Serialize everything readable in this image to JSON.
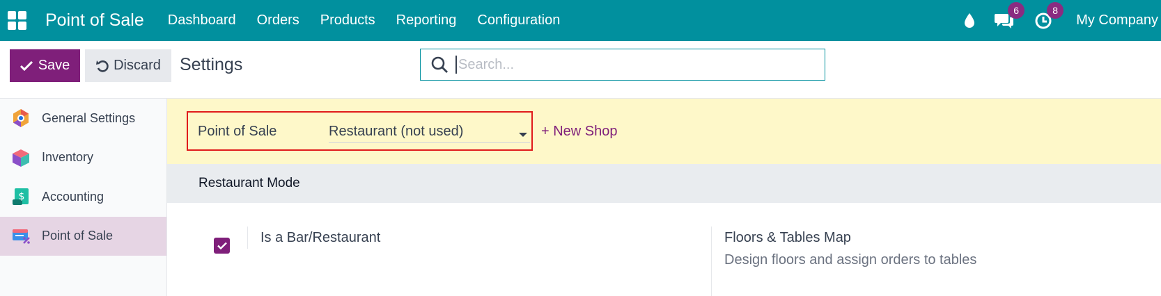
{
  "navbar": {
    "app_title": "Point of Sale",
    "menu": [
      "Dashboard",
      "Orders",
      "Products",
      "Reporting",
      "Configuration"
    ],
    "chat_count": "6",
    "activity_count": "8",
    "company": "My Company"
  },
  "toolbar": {
    "save_label": "Save",
    "discard_label": "Discard",
    "page_title": "Settings",
    "search_placeholder": "Search..."
  },
  "sidebar": {
    "items": [
      {
        "label": "General Settings"
      },
      {
        "label": "Inventory"
      },
      {
        "label": "Accounting"
      },
      {
        "label": "Point of Sale"
      }
    ],
    "active_index": 3
  },
  "banner": {
    "pos_label": "Point of Sale",
    "pos_selected": "Restaurant (not used)",
    "new_shop_label": "+ New Shop"
  },
  "section": {
    "title": "Restaurant Mode",
    "bar_restaurant_label": "Is a Bar/Restaurant",
    "bar_restaurant_checked": true,
    "floors_title": "Floors & Tables Map",
    "floors_desc": "Design floors and assign orders to tables"
  },
  "colors": {
    "navbar": "#01909e",
    "primary": "#7f1f7a",
    "banner": "#fef8c9",
    "highlight": "#e01b1b"
  }
}
